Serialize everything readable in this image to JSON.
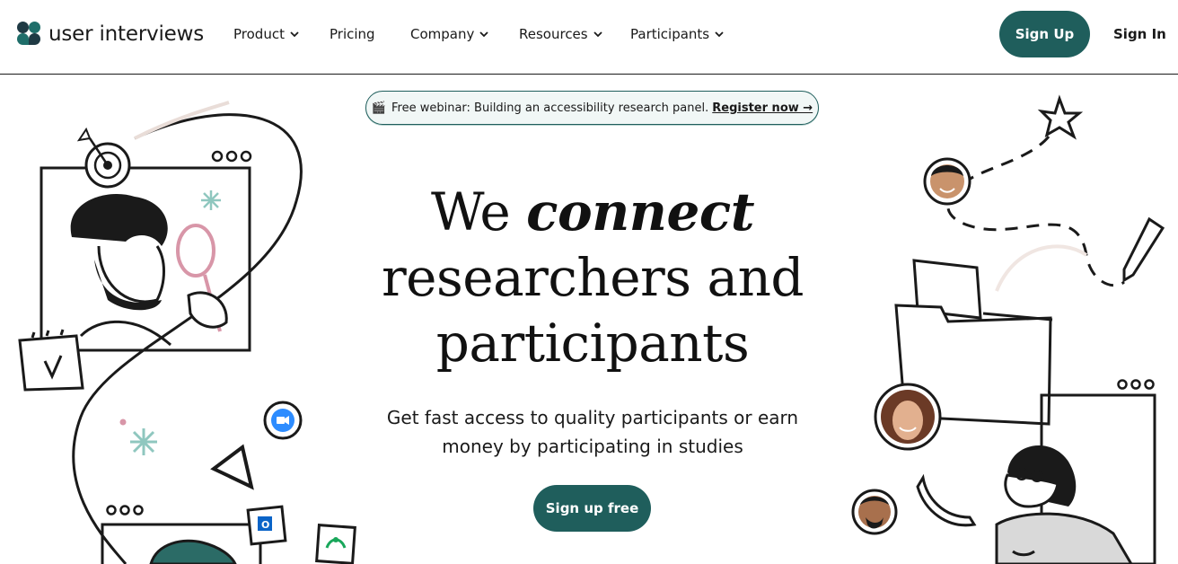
{
  "brand": {
    "name": "user interviews"
  },
  "nav": {
    "items": [
      {
        "label": "Product",
        "has_menu": true
      },
      {
        "label": "Pricing",
        "has_menu": false
      },
      {
        "label": "Company",
        "has_menu": true
      },
      {
        "label": "Resources",
        "has_menu": true
      },
      {
        "label": "Participants",
        "has_menu": true
      }
    ],
    "signup_label": "Sign Up",
    "signin_label": "Sign In"
  },
  "banner": {
    "icon": "clapperboard-icon",
    "text": "Free webinar: Building an accessibility research panel.",
    "link_label": "Register now →"
  },
  "hero": {
    "line1_prefix": "We",
    "line1_emphasis": "connect",
    "line2": "researchers and",
    "line3": "participants",
    "subtitle_line1": "Get fast access to quality participants or earn",
    "subtitle_line2": "money by participating in studies",
    "cta_label": "Sign up free"
  },
  "colors": {
    "accent": "#1f5e5c",
    "text": "#1a1a1a",
    "banner_bg": "#f1f7f6"
  }
}
